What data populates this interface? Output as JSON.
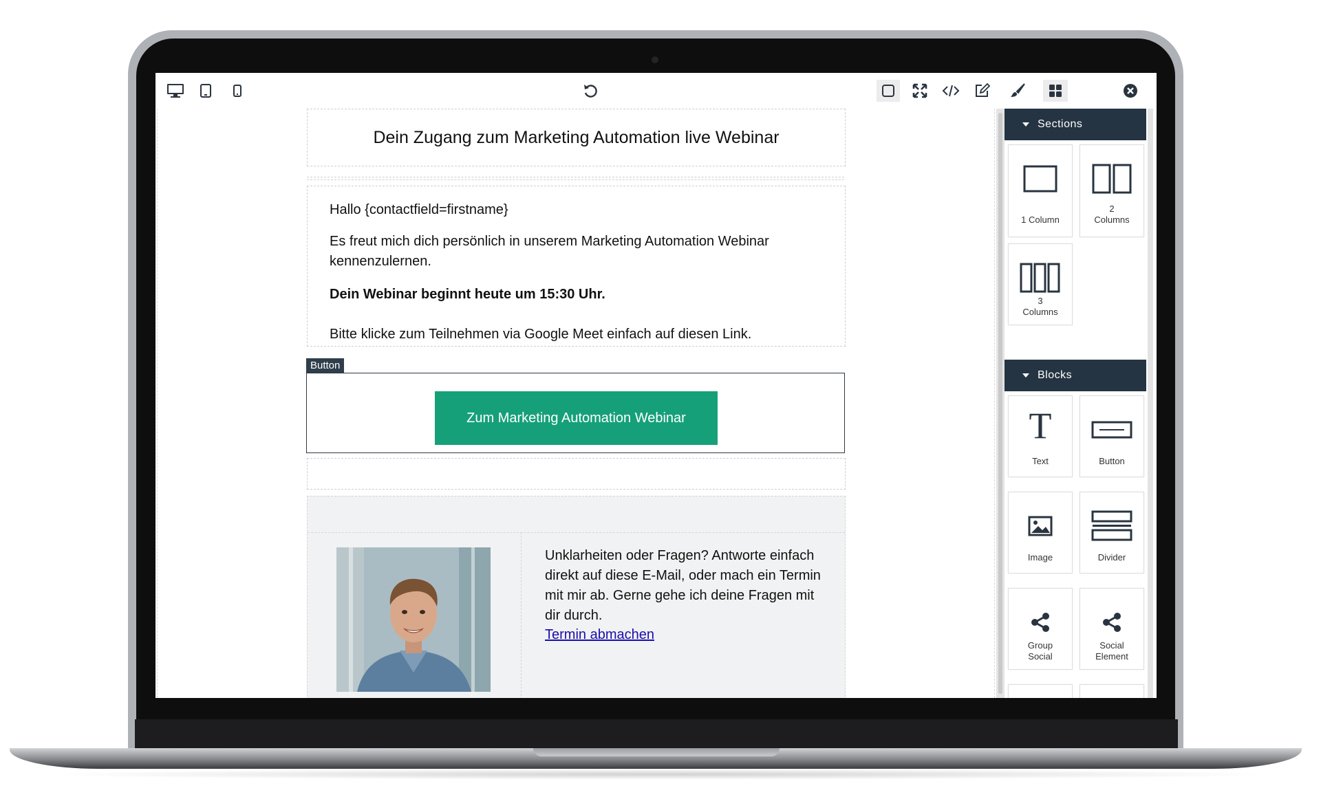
{
  "toolbar": {
    "left_icons": [
      "desktop-icon",
      "tablet-icon",
      "mobile-icon"
    ],
    "center_icons": [
      "undo-icon"
    ],
    "right_icons": [
      "select-frame-icon",
      "fullscreen-icon",
      "code-icon",
      "edit-icon",
      "paint-brush-icon",
      "blocks-grid-icon",
      "close-icon"
    ]
  },
  "email": {
    "title": "Dein Zugang zum Marketing Automation live Webinar",
    "greeting": "Hallo {contactfield=firstname}",
    "intro": "Es freut mich dich persönlich in unserem Marketing Automation Webinar kennenzulernen.",
    "start_time": "Dein Webinar beginnt heute um 15:30 Uhr.",
    "instruction": "Bitte klicke zum Teilnehmen via Google Meet einfach auf diesen Link.",
    "selected_tag": "Button",
    "cta_label": "Zum Marketing Automation Webinar",
    "footer_text": "Unklarheiten oder Fragen? Antworte einfach direkt auf diese E-Mail, oder mach ein Termin mit mir ab. Gerne gehe ich deine Fragen mit dir durch.",
    "footer_link": "Termin abmachen"
  },
  "panel": {
    "sections_title": "Sections",
    "sections": [
      {
        "icon": "one-column-icon",
        "label": "1 Column"
      },
      {
        "icon": "two-columns-icon",
        "label": "2\nColumns"
      },
      {
        "icon": "three-columns-icon",
        "label": "3\nColumns"
      }
    ],
    "blocks_title": "Blocks",
    "blocks": [
      {
        "icon": "text-icon",
        "label": "Text"
      },
      {
        "icon": "button-icon",
        "label": "Button"
      },
      {
        "icon": "image-icon",
        "label": "Image"
      },
      {
        "icon": "divider-icon",
        "label": "Divider"
      },
      {
        "icon": "share-icon",
        "label": "Group\nSocial"
      },
      {
        "icon": "share-icon",
        "label": "Social\nElement"
      }
    ]
  },
  "colors": {
    "cta": "#16a07a",
    "panel_header": "#243442",
    "link": "#1a0dab"
  }
}
